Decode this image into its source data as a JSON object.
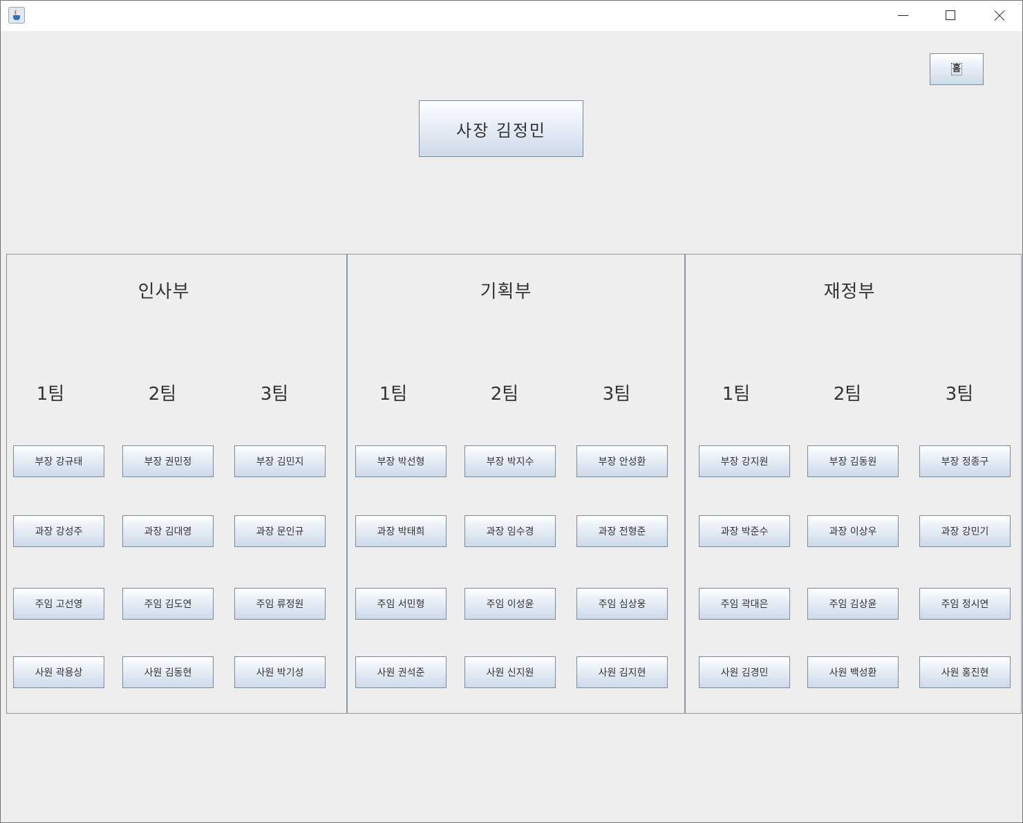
{
  "window": {
    "app_icon": "java-cup-icon",
    "min_icon": "minimize-icon",
    "max_icon": "maximize-icon",
    "close_icon": "close-icon"
  },
  "home_button": {
    "label": "홈"
  },
  "ceo_button": {
    "label": "사장 김정민"
  },
  "departments": [
    {
      "name": "인사부",
      "teams": [
        {
          "label": "1팀",
          "members": [
            "부장 강규태",
            "과장 강성주",
            "주임 고선영",
            "사원 곽용상"
          ]
        },
        {
          "label": "2팀",
          "members": [
            "부장 권민정",
            "과장 김대영",
            "주임 김도연",
            "사원 김동현"
          ]
        },
        {
          "label": "3팀",
          "members": [
            "부장 김민지",
            "과장 문인규",
            "주임 류정원",
            "사원 박기성"
          ]
        }
      ]
    },
    {
      "name": "기획부",
      "teams": [
        {
          "label": "1팀",
          "members": [
            "부장 박선형",
            "과장 박태희",
            "주임 서민형",
            "사원 권석준"
          ]
        },
        {
          "label": "2팀",
          "members": [
            "부장 박지수",
            "과장 임수경",
            "주임 이성윤",
            "사원 신지원"
          ]
        },
        {
          "label": "3팀",
          "members": [
            "부장 안성환",
            "과장 전형준",
            "주임 심상웅",
            "사원 김지현"
          ]
        }
      ]
    },
    {
      "name": "재정부",
      "teams": [
        {
          "label": "1팀",
          "members": [
            "부장 강지원",
            "과장 박준수",
            "주임 곽대은",
            "사원 김경민"
          ]
        },
        {
          "label": "2팀",
          "members": [
            "부장 김동원",
            "과장 이상우",
            "주임 김상윤",
            "사원 백성환"
          ]
        },
        {
          "label": "3팀",
          "members": [
            "부장 정종구",
            "과장 강민기",
            "주임 정시연",
            "사원 홍진현"
          ]
        }
      ]
    }
  ]
}
